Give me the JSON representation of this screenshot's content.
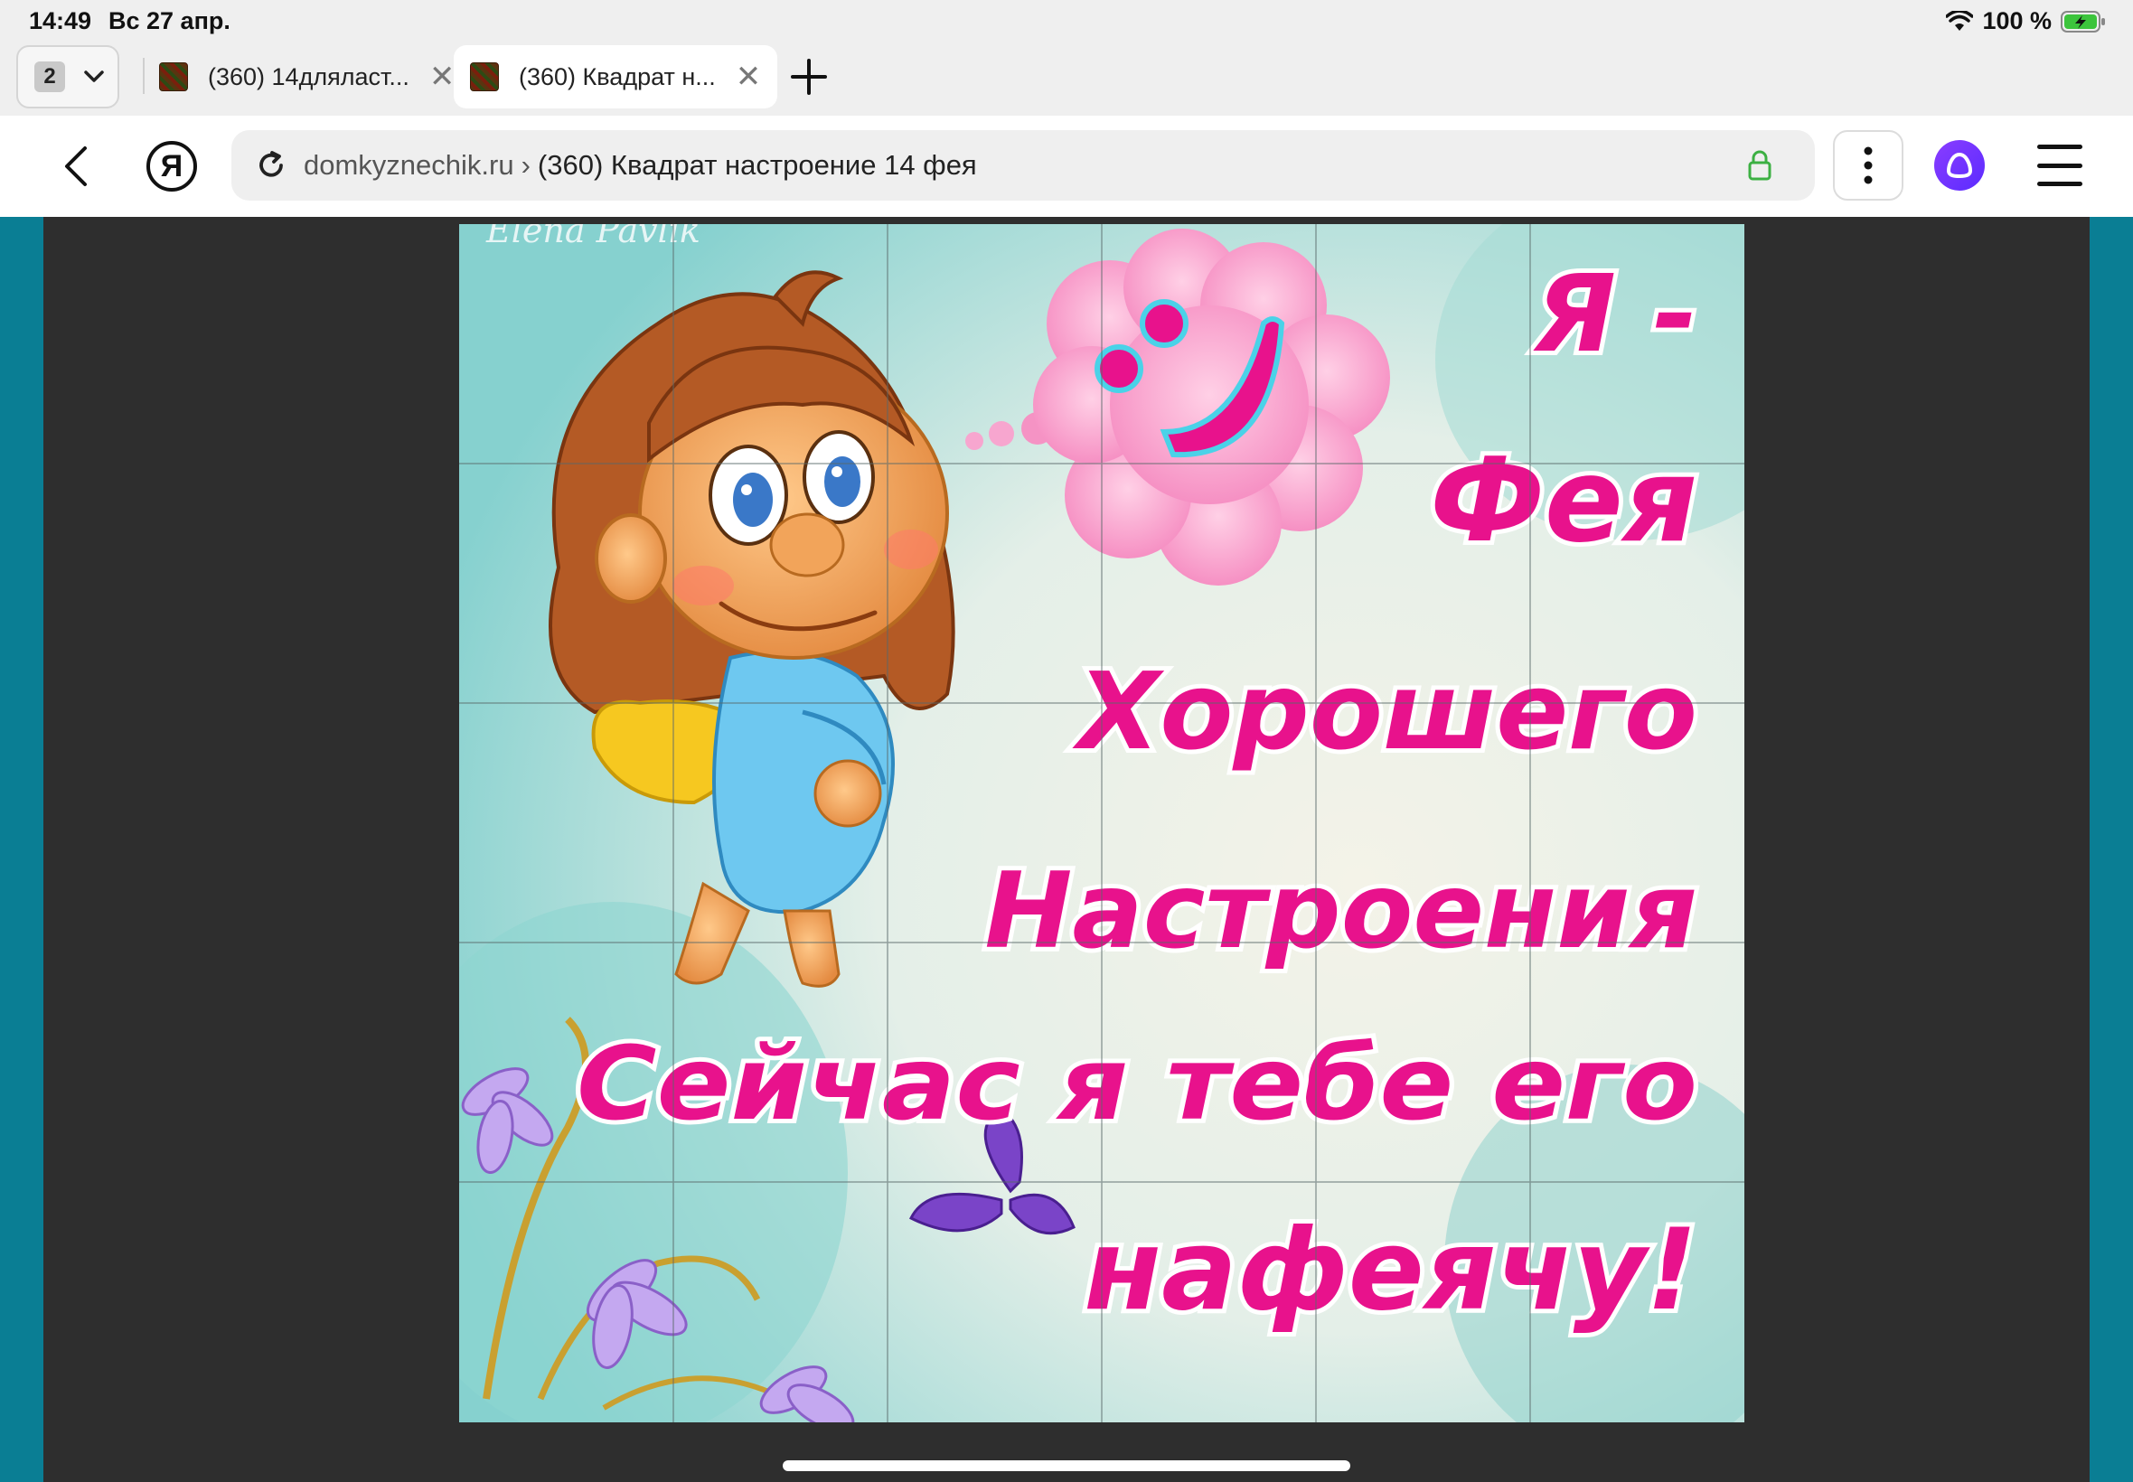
{
  "status": {
    "time": "14:49",
    "date": "Вс 27 апр.",
    "battery": "100 %"
  },
  "tabs": {
    "count": "2",
    "items": [
      {
        "title": "(360) 14дляласт..."
      },
      {
        "title": "(360) Квадрат н..."
      }
    ]
  },
  "address": {
    "domain": "domkyznechik.ru",
    "separator": "›",
    "page_title": "(360) Квадрат настроение 14 фея"
  },
  "toolbar": {
    "ya_label": "Я"
  },
  "picture": {
    "watermark": "Elena Pavlik",
    "lines": [
      "Я -",
      "Фея",
      "Хорошего",
      "Настроения",
      "Сейчас я тебе его",
      "нафеячу!"
    ]
  },
  "colors": {
    "accent": "#0a7e94",
    "caption": "#e8128c",
    "lock": "#3cb043",
    "alice": "#6a33ff"
  }
}
